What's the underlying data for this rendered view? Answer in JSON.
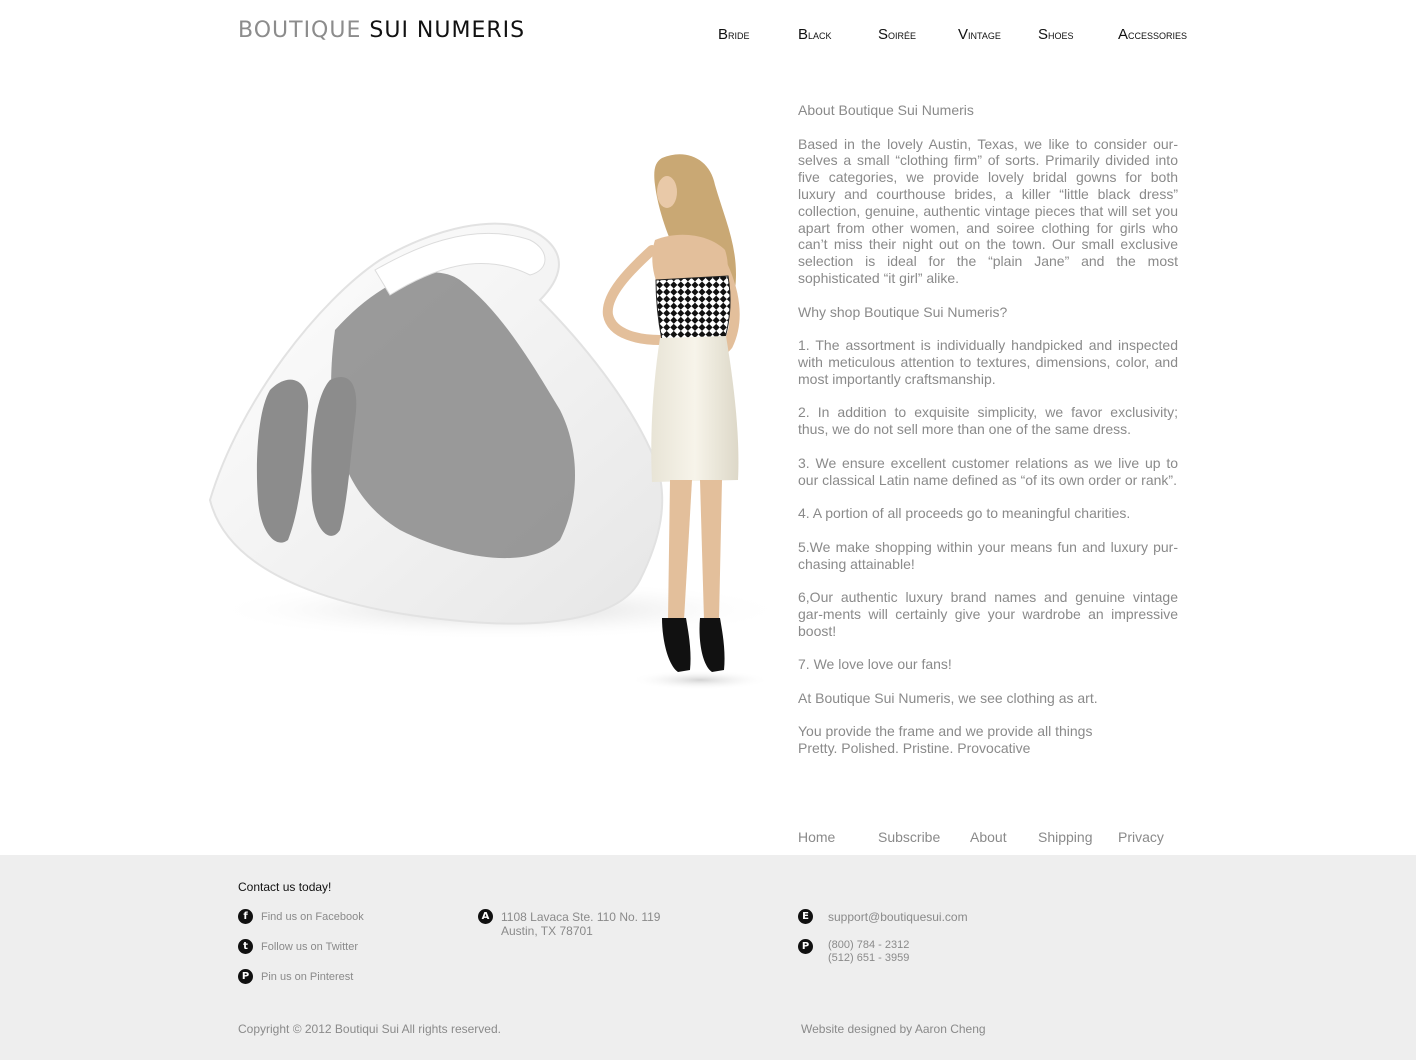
{
  "brand": {
    "logo_part1": "BOUTIQUE",
    "logo_part2": "SUI NUMERIS"
  },
  "nav": [
    "Bride",
    "Black",
    "Soirée",
    "Vintage",
    "Shoes",
    "Accessories"
  ],
  "hero": {
    "alt": "Model in checkered strapless top and white skirt beside white sculptural chair"
  },
  "content": {
    "heading": "About Boutique Sui Numeris",
    "paragraphs": [
      "Based in the lovely Austin, Texas, we like to consider our-selves a small “clothing firm” of sorts. Primarily divided into five categories, we provide lovely bridal gowns for both luxury and courthouse brides, a killer “little black dress” collection, genuine, authentic vintage pieces that will set you apart from other women, and soiree clothing for girls who can’t miss their night out on the town. Our small exclusive selection is ideal for the “plain Jane” and the most sophisticated “it girl” alike.",
      "Why shop Boutique Sui Numeris?",
      "1. The assortment is individually handpicked and inspected with meticulous attention to textures, dimensions, color, and most importantly craftsmanship.",
      "2. In addition to exquisite simplicity, we favor exclusivity; thus, we do not sell more than one of the same dress.",
      "3. We ensure excellent customer relations as we live up to our classical Latin name defined as “of its own order or rank”.",
      "4.  A portion of all proceeds go to meaningful charities.",
      "5.We make shopping within your means fun and luxury pur-chasing attainable!",
      "6,Our authentic luxury brand names and genuine vintage gar-ments will certainly give your wardrobe an impressive boost!",
      "7. We love love our fans!",
      "At Boutique Sui Numeris, we see clothing as art.",
      "You provide the frame and we provide all things",
      "Pretty. Polished. Pristine. Provocative"
    ]
  },
  "footer_links": [
    "Home",
    "Subscribe",
    "About",
    "Shipping",
    "Privacy"
  ],
  "footer": {
    "contact_title": "Contact us today!",
    "social": [
      {
        "icon": "facebook-icon",
        "glyph": "f",
        "label": "Find us on Facebook"
      },
      {
        "icon": "twitter-icon",
        "glyph": "t",
        "label": "Follow us on Twitter"
      },
      {
        "icon": "pinterest-icon",
        "glyph": "P",
        "label": "Pin us on Pinterest"
      }
    ],
    "address": {
      "icon_letter": "A",
      "line1": "1108 Lavaca Ste. 110 No. 119",
      "line2": "Austin, TX 78701"
    },
    "email": {
      "icon_letter": "E",
      "value": "support@boutiquesui.com"
    },
    "phone": {
      "icon_letter": "P",
      "line1": "(800) 784 - 2312",
      "line2": "(512) 651 - 3959"
    },
    "copyright": "Copyright © 2012 Boutiqui Sui All rights reserved.",
    "designed_by": "Website designed by  Aaron Cheng"
  },
  "colors": {
    "text_gray": "#8a8a8a",
    "nav_black": "#111111",
    "footer_bg": "#eeeeee"
  }
}
